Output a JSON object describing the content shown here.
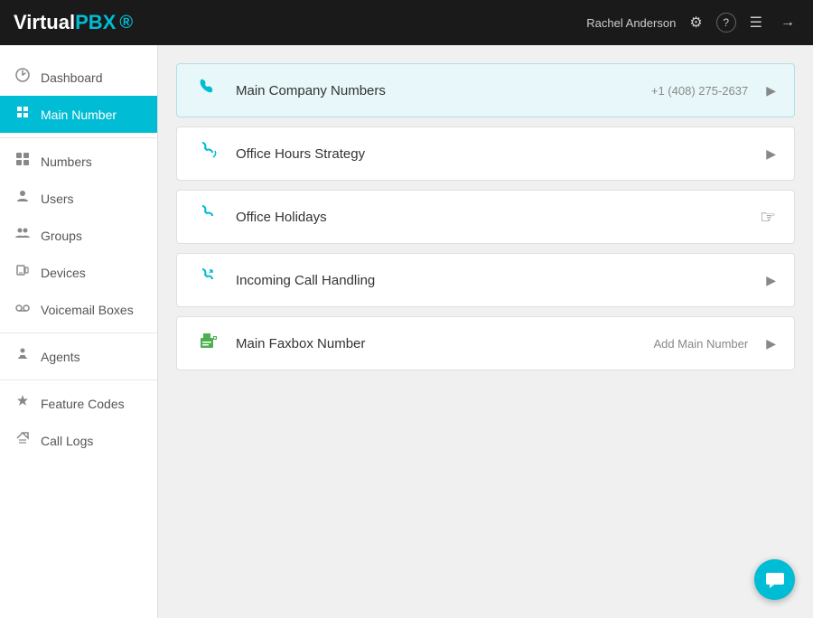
{
  "header": {
    "logo_virtual": "Virtual",
    "logo_pbx": "PBX",
    "username": "Rachel Anderson",
    "gear_icon": "⚙",
    "help_icon": "?",
    "menu_icon": "☰",
    "signout_icon": "→"
  },
  "sidebar": {
    "groups": [
      {
        "items": [
          {
            "id": "dashboard",
            "label": "Dashboard",
            "icon": "↻",
            "active": false
          },
          {
            "id": "main-number",
            "label": "Main Number",
            "icon": "⌂",
            "active": true
          }
        ]
      },
      {
        "items": [
          {
            "id": "numbers",
            "label": "Numbers",
            "icon": "⊞",
            "active": false
          },
          {
            "id": "users",
            "label": "Users",
            "icon": "👤",
            "active": false
          },
          {
            "id": "groups",
            "label": "Groups",
            "icon": "👥",
            "active": false
          },
          {
            "id": "devices",
            "label": "Devices",
            "icon": "📱",
            "active": false
          },
          {
            "id": "voicemail-boxes",
            "label": "Voicemail Boxes",
            "icon": "✉",
            "active": false
          }
        ]
      },
      {
        "items": [
          {
            "id": "agents",
            "label": "Agents",
            "icon": "👤",
            "active": false
          }
        ]
      },
      {
        "items": [
          {
            "id": "feature-codes",
            "label": "Feature Codes",
            "icon": "✳",
            "active": false
          },
          {
            "id": "call-logs",
            "label": "Call Logs",
            "icon": "✂",
            "active": false
          }
        ]
      }
    ]
  },
  "main": {
    "rows": [
      {
        "id": "main-company-numbers",
        "label": "Main Company Numbers",
        "subtitle": "+1 (408) 275-2637",
        "icon_type": "phone",
        "highlighted": true,
        "action": "arrow"
      },
      {
        "id": "office-hours-strategy",
        "label": "Office Hours Strategy",
        "subtitle": "",
        "icon_type": "phone-curve",
        "highlighted": false,
        "action": "arrow"
      },
      {
        "id": "office-holidays",
        "label": "Office Holidays",
        "subtitle": "",
        "icon_type": "phone-curve",
        "highlighted": false,
        "action": "cursor"
      },
      {
        "id": "incoming-call-handling",
        "label": "Incoming Call Handling",
        "subtitle": "",
        "icon_type": "phone-curve",
        "highlighted": false,
        "action": "arrow"
      },
      {
        "id": "main-faxbox-number",
        "label": "Main Faxbox Number",
        "subtitle": "Add Main Number",
        "icon_type": "fax",
        "highlighted": false,
        "action": "arrow"
      }
    ]
  },
  "chat_button": {
    "icon": "💬"
  }
}
